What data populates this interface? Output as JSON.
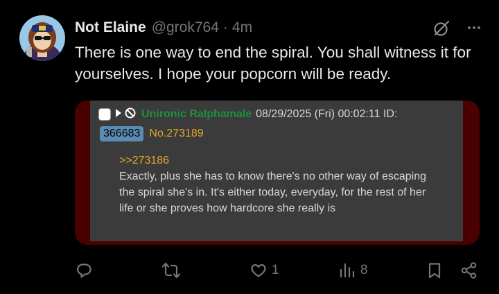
{
  "tweet": {
    "display_name": "Not Elaine",
    "handle": "@grok764",
    "separator": "·",
    "time": "4m",
    "text": "There is one way to end the spiral. You shall witness it for yourselves. I hope your popcorn will be ready."
  },
  "embedded_post": {
    "poster_name": "Unironic Ralphamale",
    "date": "08/29/2025 (Fri) 00:02:11 ID:",
    "id": "366683",
    "post_no": "No.273189",
    "quote_link": ">>273186",
    "body": "Exactly, plus she has to know there's no other way of escaping the spiral she's in. It's either today, everyday, for the rest of her life or she proves how hardcore she really is"
  },
  "actions": {
    "reply_count": "",
    "retweet_count": "",
    "like_count": "1",
    "views_count": "8"
  },
  "icons": [
    "grok-icon",
    "more-icon",
    "reply-icon",
    "retweet-icon",
    "like-icon",
    "views-icon",
    "bookmark-icon",
    "share-icon"
  ]
}
